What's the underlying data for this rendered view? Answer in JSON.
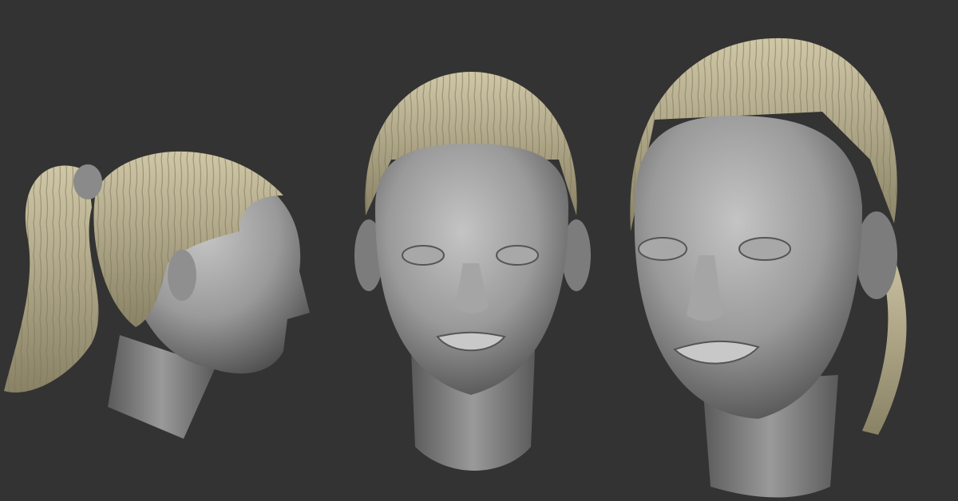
{
  "colors": {
    "background": "#333333",
    "skin_light": "#b9b9b9",
    "skin_mid": "#8c8c8c",
    "skin_dark": "#4a4a4a",
    "hair_light": "#cfc7a6",
    "hair_dark": "#8a8265"
  }
}
